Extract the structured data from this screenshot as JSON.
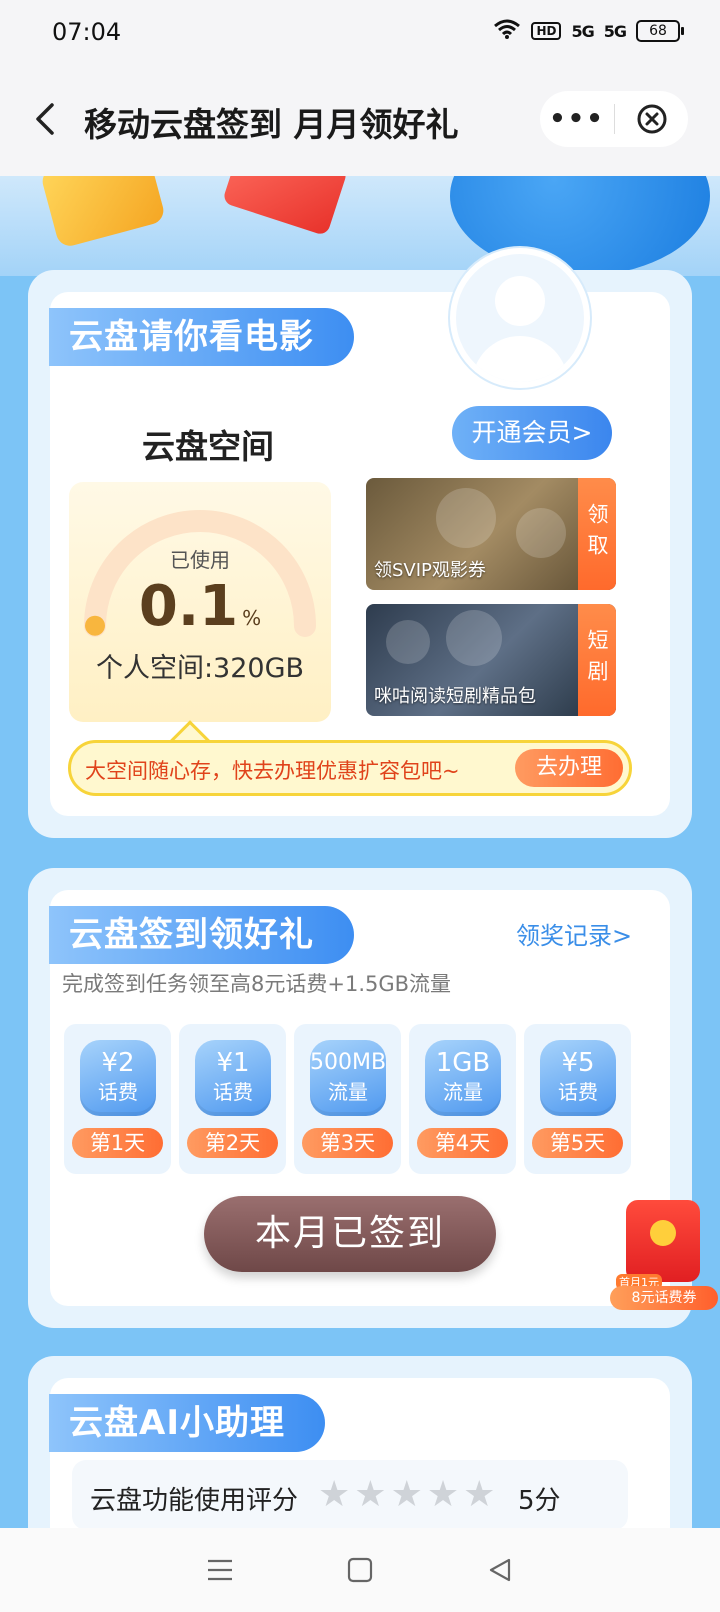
{
  "status_bar": {
    "time": "07:04",
    "hd": "HD",
    "sig1": "5G",
    "sig2": "5G",
    "battery": "68"
  },
  "header": {
    "title": "移动云盘签到 月月领好礼"
  },
  "card_movie": {
    "title": "云盘请你看电影",
    "space_label": "云盘空间",
    "vip_button": "开通会员>",
    "used_label": "已使用",
    "used_value": "0.1",
    "used_unit": "%",
    "used_fraction": 0.001,
    "personal_space": "个人空间:320GB",
    "promos": [
      {
        "text": "领SVIP观影券",
        "tag": "领取"
      },
      {
        "text": "咪咕阅读短剧精品包",
        "tag": "短剧"
      }
    ],
    "tip_text": "大空间随心存，快去办理优惠扩容包吧~",
    "tip_button": "去办理"
  },
  "card_signin": {
    "title": "云盘签到领好礼",
    "record_link": "领奖记录>",
    "desc": "完成签到任务领至高8元话费+1.5GB流量",
    "days": [
      {
        "amount": "¥2",
        "kind": "话费",
        "label": "第1天"
      },
      {
        "amount": "¥1",
        "kind": "话费",
        "label": "第2天"
      },
      {
        "amount": "500MB",
        "kind": "流量",
        "label": "第3天"
      },
      {
        "amount": "1GB",
        "kind": "流量",
        "label": "第4天"
      },
      {
        "amount": "¥5",
        "kind": "话费",
        "label": "第5天"
      }
    ],
    "signed_button": "本月已签到"
  },
  "float_coupon": {
    "small": "首月1元",
    "label": "8元话费券"
  },
  "card_ai": {
    "title": "云盘AI小助理",
    "rating_label": "云盘功能使用评分",
    "rating_stars": 0,
    "rating_max": 5,
    "score": "5分"
  },
  "colors": {
    "accent_blue": "#3d8ef2",
    "orange": "#ff6d33",
    "background": "#7cc4f6"
  }
}
